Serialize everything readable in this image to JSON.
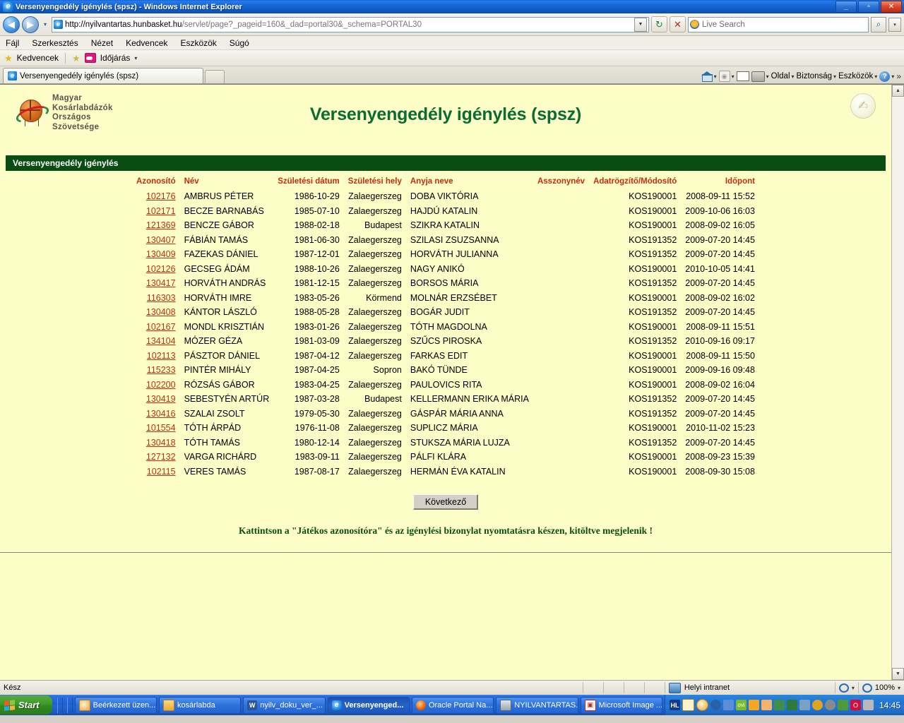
{
  "window": {
    "title": "Versenyengedély igénylés (spsz) - Windows Internet Explorer",
    "minimize_label": "_",
    "maximize_label": "▫",
    "close_label": "✕"
  },
  "nav": {
    "back_label": "◀",
    "forward_label": "▶",
    "recent_label": "▾",
    "url_host": "http://nyilvantartas.hunbasket.hu",
    "url_path": "/servlet/page?_pageid=160&_dad=portal30&_schema=PORTAL30",
    "address_dropdown_label": "▼",
    "refresh_label": "↻",
    "stop_label": "✕",
    "search_placeholder": "Live Search",
    "search_go_label": "⌕",
    "search_dropdown_label": "▾"
  },
  "menubar": {
    "items": [
      "Fájl",
      "Szerkesztés",
      "Nézet",
      "Kedvencek",
      "Eszközök",
      "Súgó"
    ]
  },
  "favbar": {
    "favorites_label": "Kedvencek",
    "weather_label": "Időjárás",
    "weather_caret": "▾"
  },
  "tabs": {
    "items": [
      {
        "label": "Versenyengedély igénylés (spsz)"
      }
    ],
    "new_tab_label": ""
  },
  "commandbar": {
    "home_caret": "▾",
    "feeds_caret": "▾",
    "print_caret": "▾",
    "page_label": "Oldal",
    "page_caret": "▾",
    "safety_label": "Biztonság",
    "safety_caret": "▾",
    "tools_label": "Eszközök",
    "tools_caret": "▾",
    "help_label": "?",
    "help_caret": "▾",
    "overflow_label": "»"
  },
  "page": {
    "logo_lines": [
      "Magyar",
      "Kosárlabdázók",
      "Országos",
      "Szövetsége"
    ],
    "title": "Versenyengedély igénylés (spsz)",
    "corner_icon_label": "✍",
    "section_title": "Versenyengedély igénylés",
    "next_button": "Következő",
    "notice": "Kattintson a \"Játékos azonosítóra\" és az igénylési bizonylat nyomtatásra készen, kitöltve megjelenik !",
    "table": {
      "columns": [
        "Azonosító",
        "Név",
        "Születési dátum",
        "Születési hely",
        "Anyja neve",
        "Asszonynév",
        "Adatrögzítő/Módosító",
        "Időpont"
      ],
      "rows": [
        {
          "id": "102176",
          "name": "AMBRUS PÉTER",
          "birth_date": "1986-10-29",
          "birth_place": "Zalaegerszeg",
          "mother": "DOBA VIKTÓRIA",
          "married_name": "",
          "recorder": "KOS190001",
          "timestamp": "2008-09-11 15:52"
        },
        {
          "id": "102171",
          "name": "BECZE BARNABÁS",
          "birth_date": "1985-07-10",
          "birth_place": "Zalaegerszeg",
          "mother": "HAJDÚ KATALIN",
          "married_name": "",
          "recorder": "KOS190001",
          "timestamp": "2009-10-06 16:03"
        },
        {
          "id": "121369",
          "name": "BENCZE GÁBOR",
          "birth_date": "1988-02-18",
          "birth_place": "Budapest",
          "mother": "SZIKRA KATALIN",
          "married_name": "",
          "recorder": "KOS190001",
          "timestamp": "2008-09-02 16:05"
        },
        {
          "id": "130407",
          "name": "FÁBIÁN TAMÁS",
          "birth_date": "1981-06-30",
          "birth_place": "Zalaegerszeg",
          "mother": "SZILASI ZSUZSANNA",
          "married_name": "",
          "recorder": "KOS191352",
          "timestamp": "2009-07-20 14:45"
        },
        {
          "id": "130409",
          "name": "FAZEKAS DÁNIEL",
          "birth_date": "1987-12-01",
          "birth_place": "Zalaegerszeg",
          "mother": "HORVÁTH JULIANNA",
          "married_name": "",
          "recorder": "KOS191352",
          "timestamp": "2009-07-20 14:45"
        },
        {
          "id": "102126",
          "name": "GECSEG ÁDÁM",
          "birth_date": "1988-10-26",
          "birth_place": "Zalaegerszeg",
          "mother": "NAGY ANIKÓ",
          "married_name": "",
          "recorder": "KOS190001",
          "timestamp": "2010-10-05 14:41"
        },
        {
          "id": "130417",
          "name": "HORVÁTH ANDRÁS",
          "birth_date": "1981-12-15",
          "birth_place": "Zalaegerszeg",
          "mother": "BORSOS MÁRIA",
          "married_name": "",
          "recorder": "KOS191352",
          "timestamp": "2009-07-20 14:45"
        },
        {
          "id": "116303",
          "name": "HORVÁTH IMRE",
          "birth_date": "1983-05-26",
          "birth_place": "Körmend",
          "mother": "MOLNÁR ERZSÉBET",
          "married_name": "",
          "recorder": "KOS190001",
          "timestamp": "2008-09-02 16:02"
        },
        {
          "id": "130408",
          "name": "KÁNTOR LÁSZLÓ",
          "birth_date": "1988-05-28",
          "birth_place": "Zalaegerszeg",
          "mother": "BOGÁR JUDIT",
          "married_name": "",
          "recorder": "KOS191352",
          "timestamp": "2009-07-20 14:45"
        },
        {
          "id": "102167",
          "name": "MONDL KRISZTIÁN",
          "birth_date": "1983-01-26",
          "birth_place": "Zalaegerszeg",
          "mother": "TÓTH MAGDOLNA",
          "married_name": "",
          "recorder": "KOS190001",
          "timestamp": "2008-09-11 15:51"
        },
        {
          "id": "134104",
          "name": "MÓZER GÉZA",
          "birth_date": "1981-03-09",
          "birth_place": "Zalaegerszeg",
          "mother": "SZŰCS PIROSKA",
          "married_name": "",
          "recorder": "KOS191352",
          "timestamp": "2010-09-16 09:17"
        },
        {
          "id": "102113",
          "name": "PÁSZTOR DÁNIEL",
          "birth_date": "1987-04-12",
          "birth_place": "Zalaegerszeg",
          "mother": "FARKAS EDIT",
          "married_name": "",
          "recorder": "KOS190001",
          "timestamp": "2008-09-11 15:50"
        },
        {
          "id": "115233",
          "name": "PINTÉR MIHÁLY",
          "birth_date": "1987-04-25",
          "birth_place": "Sopron",
          "mother": "BAKÓ TÜNDE",
          "married_name": "",
          "recorder": "KOS190001",
          "timestamp": "2009-09-16 09:48"
        },
        {
          "id": "102200",
          "name": "RÓZSÁS GÁBOR",
          "birth_date": "1983-04-25",
          "birth_place": "Zalaegerszeg",
          "mother": "PAULOVICS RITA",
          "married_name": "",
          "recorder": "KOS190001",
          "timestamp": "2008-09-02 16:04"
        },
        {
          "id": "130419",
          "name": "SEBESTYÉN ARTÚR",
          "birth_date": "1987-03-28",
          "birth_place": "Budapest",
          "mother": "KELLERMANN ERIKA MÁRIA",
          "married_name": "",
          "recorder": "KOS191352",
          "timestamp": "2009-07-20 14:45"
        },
        {
          "id": "130416",
          "name": "SZALAI ZSOLT",
          "birth_date": "1979-05-30",
          "birth_place": "Zalaegerszeg",
          "mother": "GÁSPÁR MÁRIA ANNA",
          "married_name": "",
          "recorder": "KOS191352",
          "timestamp": "2009-07-20 14:45"
        },
        {
          "id": "101554",
          "name": "TÓTH ÁRPÁD",
          "birth_date": "1976-11-08",
          "birth_place": "Zalaegerszeg",
          "mother": "SUPLICZ MÁRIA",
          "married_name": "",
          "recorder": "KOS190001",
          "timestamp": "2010-11-02 15:23"
        },
        {
          "id": "130418",
          "name": "TÓTH TAMÁS",
          "birth_date": "1980-12-14",
          "birth_place": "Zalaegerszeg",
          "mother": "STUKSZA MÁRIA LUJZA",
          "married_name": "",
          "recorder": "KOS191352",
          "timestamp": "2009-07-20 14:45"
        },
        {
          "id": "127132",
          "name": "VARGA RICHÁRD",
          "birth_date": "1983-09-11",
          "birth_place": "Zalaegerszeg",
          "mother": "PÁLFI KLÁRA",
          "married_name": "",
          "recorder": "KOS190001",
          "timestamp": "2008-09-23 15:39"
        },
        {
          "id": "102115",
          "name": "VERES TAMÁS",
          "birth_date": "1987-08-17",
          "birth_place": "Zalaegerszeg",
          "mother": "HERMÁN ÉVA KATALIN",
          "married_name": "",
          "recorder": "KOS190001",
          "timestamp": "2008-09-30 15:08"
        }
      ]
    }
  },
  "statusbar": {
    "status": "Kész",
    "zone": "Helyi intranet",
    "zone_caret": "▾",
    "zoom": "100%",
    "zoom_caret": "▾"
  },
  "taskbar": {
    "start_label": "Start",
    "items": [
      {
        "label": "Beérkezett üzen...",
        "icon": "mail-icon",
        "active": false
      },
      {
        "label": "kosárlabda",
        "icon": "folder-icon",
        "active": false
      },
      {
        "label": "nyilv_doku_ver_...",
        "icon": "word-icon",
        "active": false
      },
      {
        "label": "Versenyenged...",
        "icon": "ie-icon",
        "active": true
      },
      {
        "label": "Oracle Portal Na...",
        "icon": "firefox-icon",
        "active": false
      },
      {
        "label": "NYILVANTARTAS...",
        "icon": "rdp-icon",
        "active": false
      },
      {
        "label": "Microsoft Image ...",
        "icon": "image-icon",
        "active": false
      }
    ],
    "tray_badge": "HL",
    "clock": "14:45"
  },
  "colors": {
    "page_background": "#fdfdc8",
    "accent_green": "#0a4d12",
    "link_red": "#c03010",
    "title_green": "#0b6b33",
    "taskbar_blue": "#1f5fd0"
  }
}
